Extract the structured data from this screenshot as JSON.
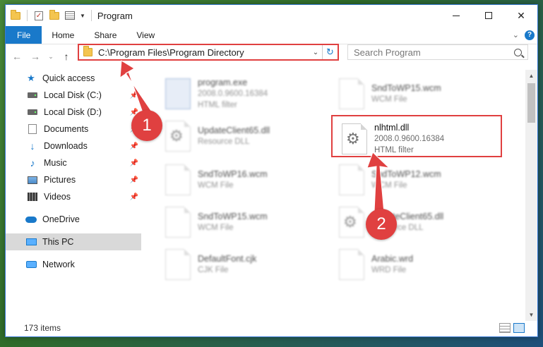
{
  "window": {
    "title": "Program",
    "controls": {
      "minimize": "minimize",
      "maximize": "maximize",
      "close": "✕"
    }
  },
  "ribbon": {
    "tabs": [
      "File",
      "Home",
      "Share",
      "View"
    ],
    "help": "?"
  },
  "nav": {
    "back": "←",
    "forward": "→",
    "up": "↑",
    "recent": "⌄"
  },
  "address": {
    "path": "C:\\Program Files\\Program Directory",
    "dropdown": "⌄",
    "refresh": "↻"
  },
  "search": {
    "placeholder": "Search Program"
  },
  "sidebar": {
    "items": [
      {
        "label": "Quick access",
        "icon": "star-icon",
        "pinned": false
      },
      {
        "label": "Local Disk (C:)",
        "icon": "disk-icon",
        "pinned": true
      },
      {
        "label": "Local Disk (D:)",
        "icon": "disk-icon",
        "pinned": true
      },
      {
        "label": "Documents",
        "icon": "documents-icon",
        "pinned": true
      },
      {
        "label": "Downloads",
        "icon": "download-icon",
        "pinned": true
      },
      {
        "label": "Music",
        "icon": "music-icon",
        "pinned": true
      },
      {
        "label": "Pictures",
        "icon": "pictures-icon",
        "pinned": true
      },
      {
        "label": "Videos",
        "icon": "videos-icon",
        "pinned": true
      },
      {
        "label": "OneDrive",
        "icon": "onedrive-icon"
      },
      {
        "label": "This PC",
        "icon": "pc-icon",
        "selected": true
      },
      {
        "label": "Network",
        "icon": "network-icon"
      }
    ]
  },
  "files": [
    {
      "name": "program.exe",
      "sub": "2008.0.9600.16384",
      "type": "HTML filter",
      "icon": "exe"
    },
    {
      "name": "SndToWP15.wcm",
      "sub": "WCM File",
      "type": "",
      "icon": "page"
    },
    {
      "name": "UpdateClient65.dll",
      "sub": "Resource DLL",
      "type": "",
      "icon": "gear"
    },
    {
      "name": "nlhtml.dll",
      "sub": "2008.0.9600.16384",
      "type": "HTML filter",
      "icon": "gear"
    },
    {
      "name": "SndToWP16.wcm",
      "sub": "WCM File",
      "type": "",
      "icon": "page"
    },
    {
      "name": "SndToWP12.wcm",
      "sub": "WCM File",
      "type": "",
      "icon": "page"
    },
    {
      "name": "SndToWP15.wcm",
      "sub": "WCM File",
      "type": "",
      "icon": "page"
    },
    {
      "name": "UpdateClient65.dll",
      "sub": "Resource DLL",
      "type": "",
      "icon": "gear"
    },
    {
      "name": "DefaultFont.cjk",
      "sub": "CJK File",
      "type": "",
      "icon": "page"
    },
    {
      "name": "Arabic.wrd",
      "sub": "WRD File",
      "type": "",
      "icon": "page"
    }
  ],
  "status": {
    "count": "173 items"
  },
  "annotations": {
    "step1": "1",
    "step2": "2"
  },
  "colors": {
    "accent": "#1979ca",
    "highlight": "#e04040"
  }
}
